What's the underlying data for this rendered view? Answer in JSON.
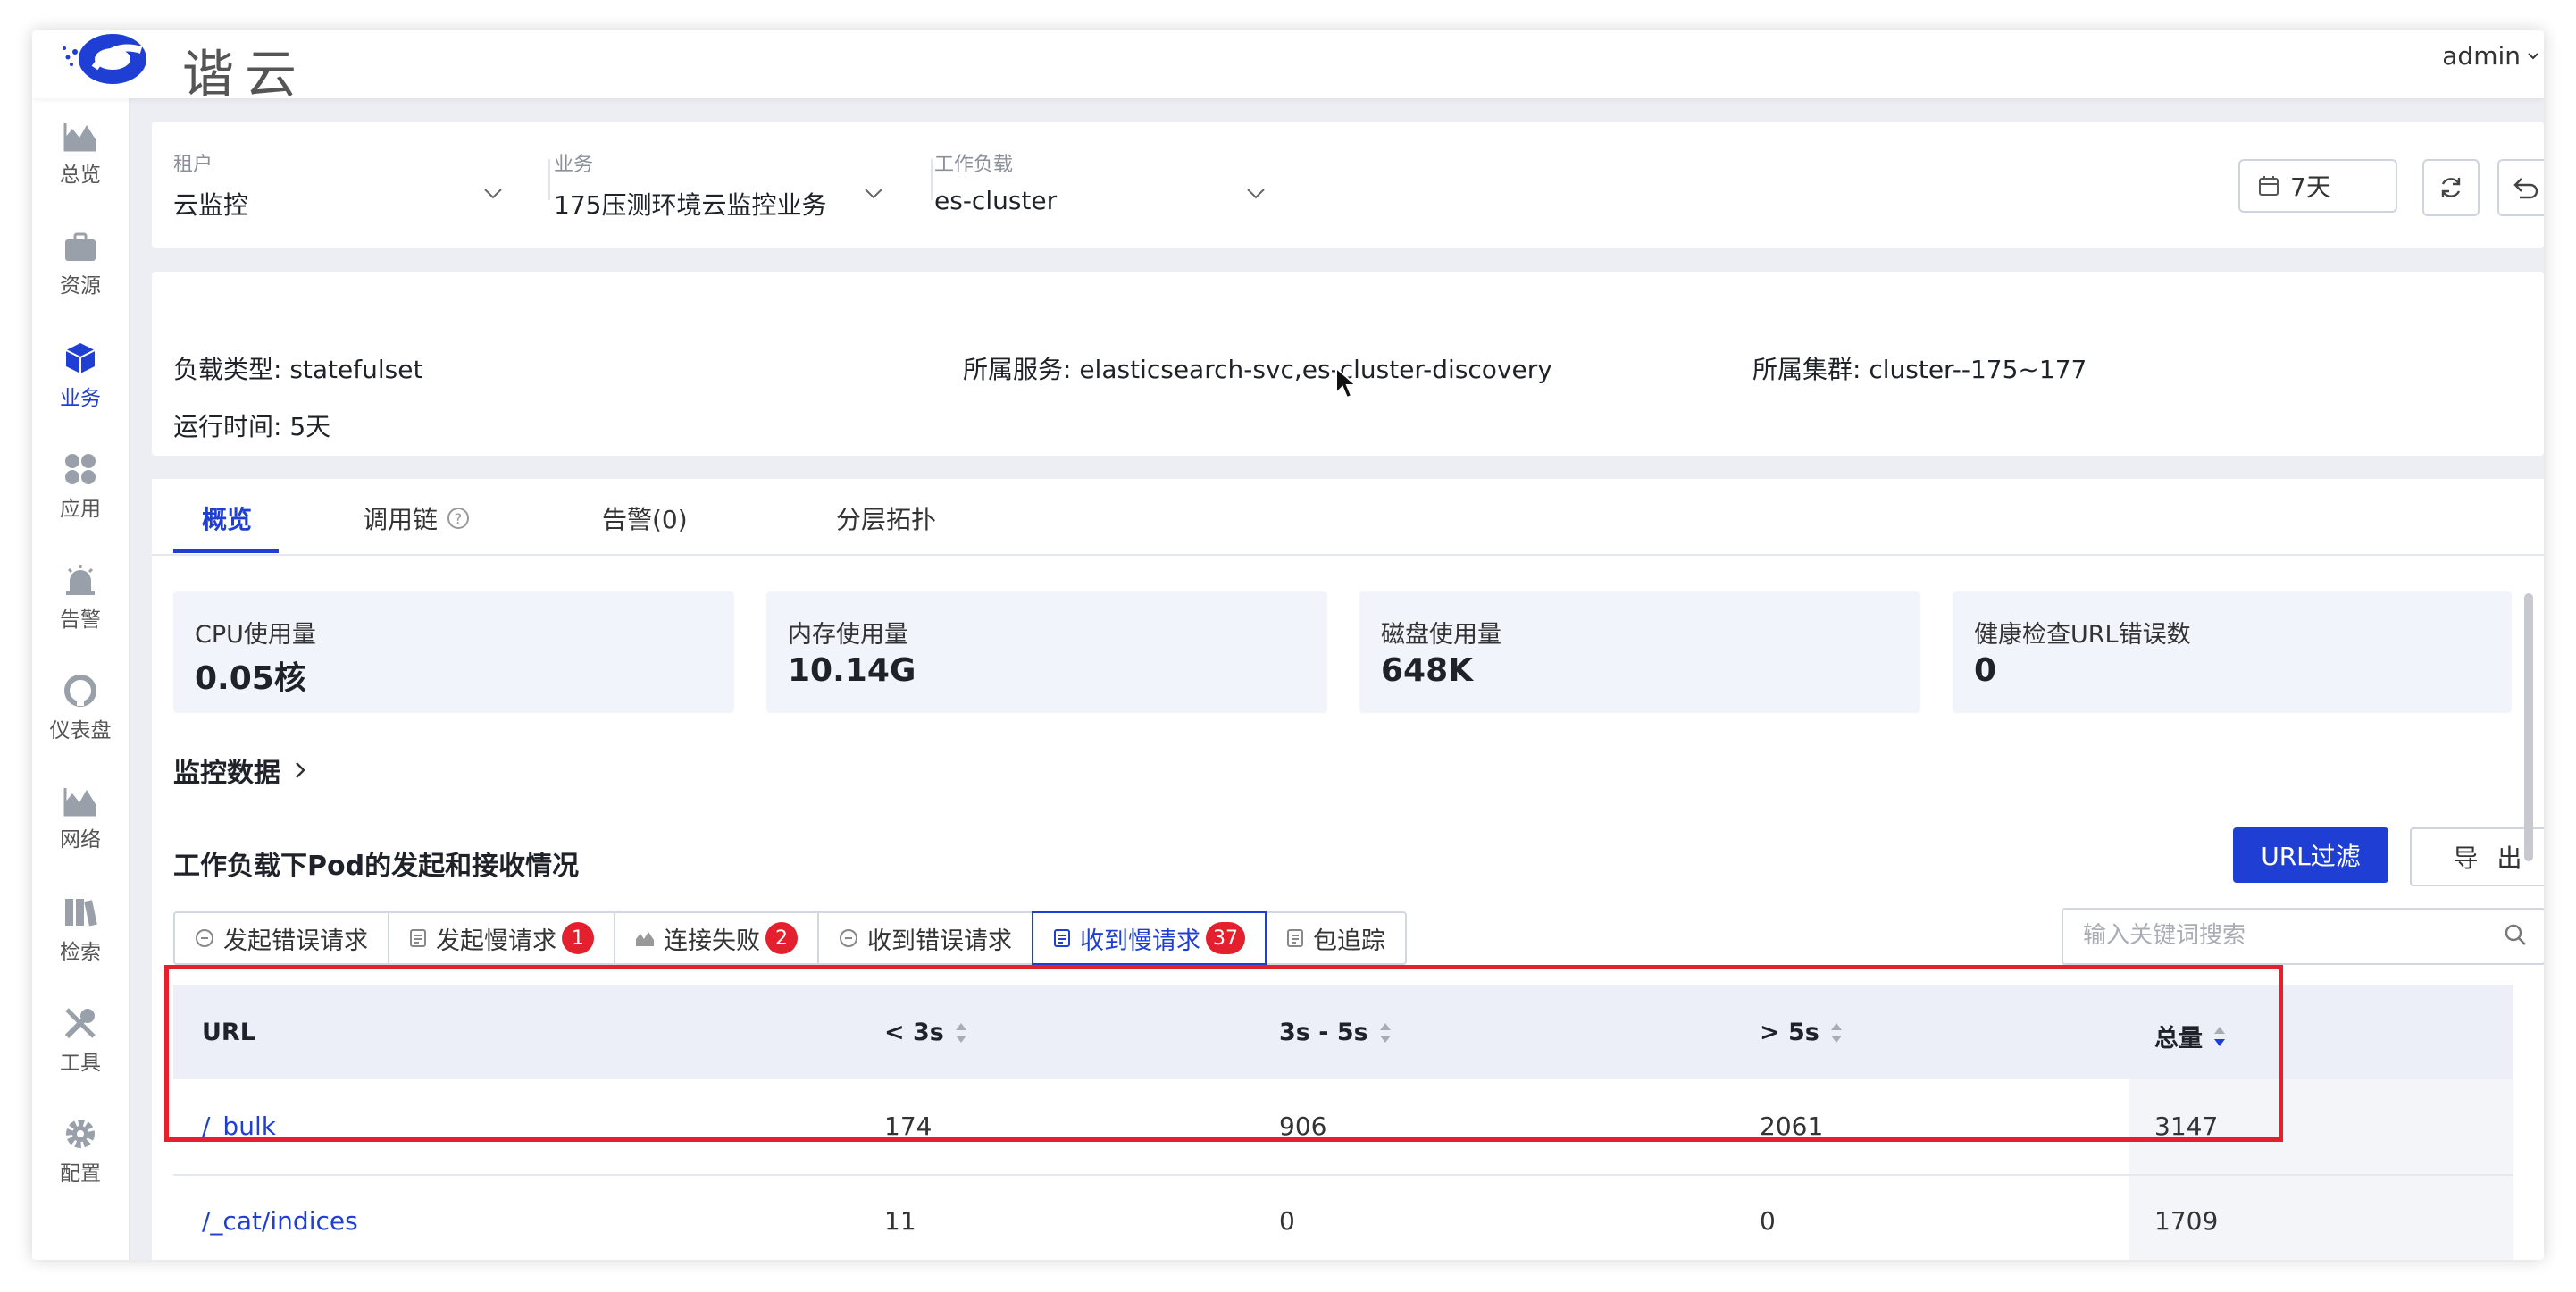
{
  "brand": {
    "name": "谐云"
  },
  "header": {
    "user": "admin"
  },
  "sidebar": {
    "items": [
      {
        "label": "总览",
        "icon": "area-chart-icon"
      },
      {
        "label": "资源",
        "icon": "briefcase-icon"
      },
      {
        "label": "业务",
        "icon": "cube-icon"
      },
      {
        "label": "应用",
        "icon": "apps-icon"
      },
      {
        "label": "告警",
        "icon": "alarm-icon"
      },
      {
        "label": "仪表盘",
        "icon": "dashboard-icon"
      },
      {
        "label": "网络",
        "icon": "network-icon"
      },
      {
        "label": "检索",
        "icon": "search-books-icon"
      },
      {
        "label": "工具",
        "icon": "tools-icon"
      },
      {
        "label": "配置",
        "icon": "gear-icon"
      }
    ],
    "active": "业务"
  },
  "filters": {
    "tenant": {
      "label": "租户",
      "value": "云监控"
    },
    "business": {
      "label": "业务",
      "value": "175压测环境云监控业务"
    },
    "workload": {
      "label": "工作负载",
      "value": "es-cluster"
    },
    "time_range": "7天"
  },
  "info": {
    "workload_type": "负载类型: statefulset",
    "services": "所属服务: elasticsearch-svc,es-cluster-discovery",
    "cluster": "所属集群: cluster--175~177",
    "runtime": "运行时间: 5天"
  },
  "tabs": [
    {
      "label": "概览",
      "active": true
    },
    {
      "label": "调用链",
      "active": false
    },
    {
      "label": "告警(0)",
      "active": false
    },
    {
      "label": "分层拓扑",
      "active": false
    }
  ],
  "metrics": [
    {
      "label": "CPU使用量",
      "value": "0.05核"
    },
    {
      "label": "内存使用量",
      "value": "10.14G"
    },
    {
      "label": "磁盘使用量",
      "value": "648K"
    },
    {
      "label": "健康检查URL错误数",
      "value": "0"
    }
  ],
  "monitor_section": {
    "title": "监控数据"
  },
  "pod_section": {
    "title": "工作负载下Pod的发起和接收情况",
    "url_filter_button": "URL过滤",
    "export_button": "导 出",
    "search_placeholder": "输入关键词搜索"
  },
  "segments": [
    {
      "label": "发起错误请求",
      "badge": ""
    },
    {
      "label": "发起慢请求",
      "badge": "1"
    },
    {
      "label": "连接失败",
      "badge": "2"
    },
    {
      "label": "收到错误请求",
      "badge": ""
    },
    {
      "label": "收到慢请求",
      "badge": "37"
    },
    {
      "label": "包追踪",
      "badge": ""
    }
  ],
  "active_segment": "收到慢请求",
  "table": {
    "columns": [
      "URL",
      "< 3s",
      "3s - 5s",
      "> 5s",
      "总量"
    ],
    "rows": [
      [
        "/_bulk",
        "174",
        "906",
        "2061",
        "3147"
      ],
      [
        "/_cat/indices",
        "11",
        "0",
        "0",
        "1709"
      ]
    ]
  },
  "colors": {
    "accent": "#1f3fd4",
    "badge": "#e5202e",
    "highlight": "#e5202e"
  }
}
